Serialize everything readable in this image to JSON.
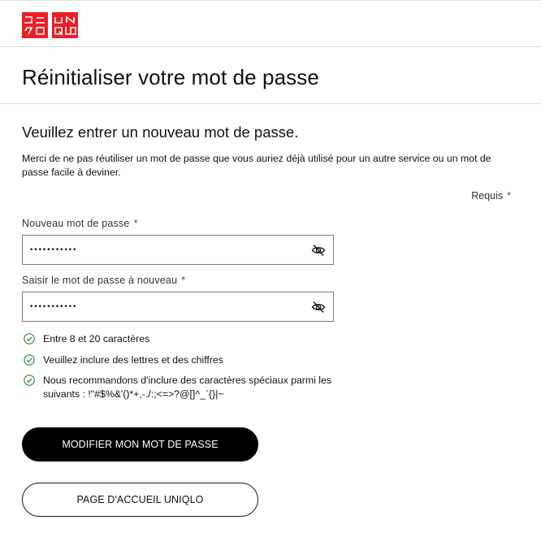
{
  "header": {
    "logo_left": "ユニクロ",
    "logo_right": "UNIQLO",
    "brand_color": "#ed1d24"
  },
  "page": {
    "title": "Réinitialiser votre mot de passe",
    "subtitle": "Veuillez entrer un nouveau mot de passe.",
    "notice": "Merci de ne pas réutiliser un mot de passe que vous auriez déjà utilisé pour un autre service ou un mot de passe facile à deviner.",
    "required_label": "Requis",
    "required_mark": "*"
  },
  "form": {
    "new_password": {
      "label": "Nouveau mot de passe",
      "mark": "*",
      "value": "•••••••••••",
      "toggle_icon": "eye-slash-icon"
    },
    "confirm_password": {
      "label": "Saisir le mot de passe à nouveau",
      "mark": "*",
      "value": "•••••••••••",
      "toggle_icon": "eye-slash-icon"
    }
  },
  "rules": [
    {
      "text": "Entre 8 et 20 caractères",
      "icon": "check-circle-icon",
      "status": "valid"
    },
    {
      "text": "Veuillez inclure des lettres et des chiffres",
      "icon": "check-circle-icon",
      "status": "valid"
    },
    {
      "text": "Nous recommandons d'inclure des caractères spéciaux parmi les suivants : !\"#$%&'()*+,-./:;<=>?@[]^_`{}|~",
      "icon": "check-circle-icon",
      "status": "valid"
    }
  ],
  "colors": {
    "check": "#2e8b3d",
    "primary_button_bg": "#000000",
    "asterisk": "#1f5aa8"
  },
  "buttons": {
    "submit": "MODIFIER MON MOT DE PASSE",
    "home": "PAGE D'ACCUEIL UNIQLO"
  }
}
